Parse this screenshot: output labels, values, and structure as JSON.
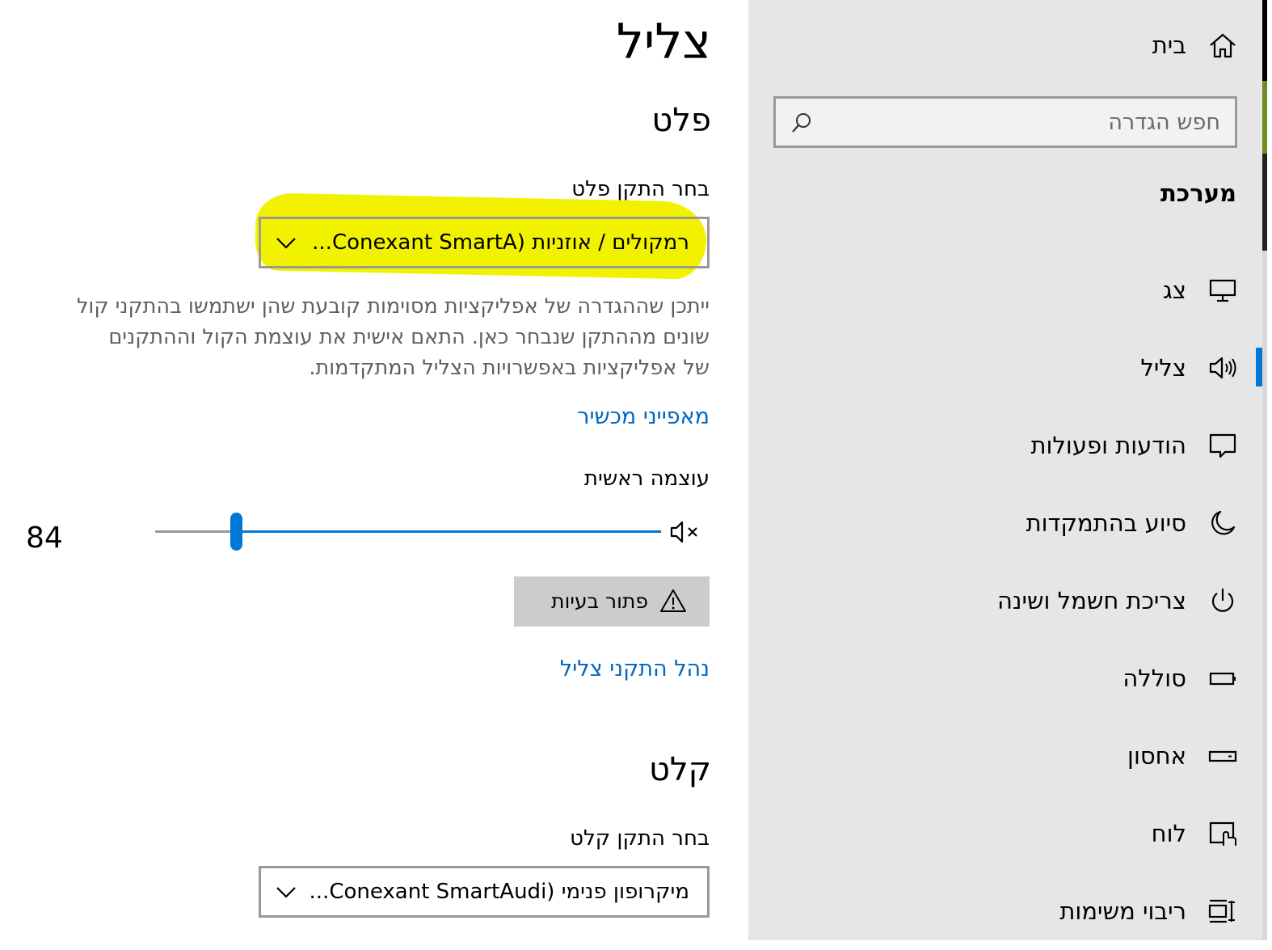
{
  "nav": {
    "home_label": "בית",
    "search": {
      "placeholder": "חפש הגדרה",
      "value": ""
    },
    "section_title": "מערכת",
    "items": [
      {
        "label": "צג",
        "icon": "monitor-icon"
      },
      {
        "label": "צליל",
        "icon": "speaker-icon",
        "selected": true
      },
      {
        "label": "הודעות ופעולות",
        "icon": "notification-icon"
      },
      {
        "label": "סיוע בהתמקדות",
        "icon": "moon-icon"
      },
      {
        "label": "צריכת חשמל ושינה",
        "icon": "power-icon"
      },
      {
        "label": "סוללה",
        "icon": "battery-icon"
      },
      {
        "label": "אחסון",
        "icon": "storage-icon"
      },
      {
        "label": "לוח",
        "icon": "tablet-icon"
      },
      {
        "label": "ריבוי משימות",
        "icon": "multitasking-icon"
      }
    ],
    "accent_color": "#0078d7"
  },
  "main": {
    "page_title": "צליל",
    "output": {
      "heading": "פלט",
      "choose_label": "בחר התקן פלט",
      "selected_device": "רמקולים / אוזניות (Conexant SmartA...",
      "description_lines": [
        "ייתכן שההגדרה של אפליקציות מסוימות קובעת שהן ישתמשו בהתקני קול",
        "שונים מההתקן שנבחר כאן. התאם אישית את עוצמת הקול וההתקנים",
        "של אפליקציות באפשרויות הצליל המתקדמות."
      ],
      "device_properties_link": "מאפייני מכשיר",
      "master_volume_label": "עוצמה ראשית",
      "volume_value": "84",
      "volume_level": 0.84,
      "troubleshoot_label": "פתור בעיות",
      "manage_devices_link": "נהל התקני צליל"
    },
    "input": {
      "heading": "קלט",
      "choose_label": "בחר התקן קלט",
      "selected_device": "מיקרופון פנימי (Conexant SmartAudi..."
    },
    "link_color": "#0067c0",
    "highlight_color": "#f2f200"
  }
}
